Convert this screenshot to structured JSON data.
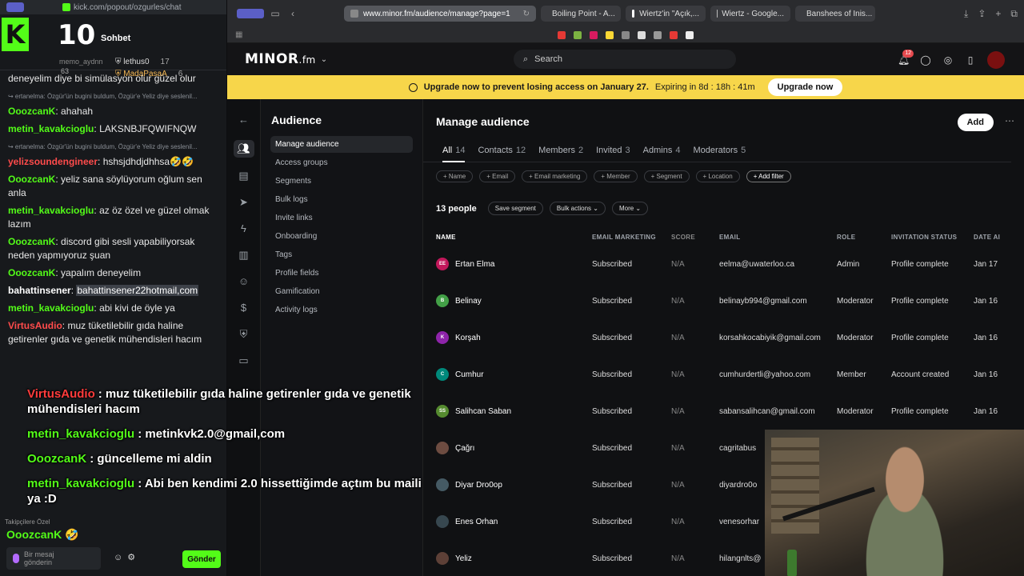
{
  "kick": {
    "url": "kick.com/popout/ozgurles/chat",
    "header_count": "10",
    "header_title": "Sohbet",
    "sub_user": "memo_aydnn",
    "sub_num": "63",
    "leaders": [
      {
        "name": "lethus0",
        "num": "17"
      },
      {
        "name": "MadaPasaA",
        "num": "6"
      }
    ],
    "messages": [
      {
        "type": "text",
        "text": "deneyelim diye bi simülasyon olur güzel olur"
      },
      {
        "type": "reply",
        "text": "↪ ertanelma: Özgür'ün bugini buldum, Özgür'e Yeliz diye seslenil..."
      },
      {
        "type": "msg",
        "user": "OoozcanK",
        "text": "ahahah"
      },
      {
        "type": "msg",
        "user": "metin_kavakcioglu",
        "text": "LAKSNBJFQWIFNQW"
      },
      {
        "type": "reply",
        "text": "↪ ertanelma: Özgür'ün bugini buldum, Özgür'e Yeliz diye seslenil..."
      },
      {
        "type": "msg",
        "user": "yelizsoundengineer",
        "text": "hshsjdhdjdhhsa🤣🤣",
        "red": true
      },
      {
        "type": "msg",
        "user": "OoozcanK",
        "text": "yeliz sana söylüyorum oğlum sen anla"
      },
      {
        "type": "msg",
        "user": "metin_kavakcioglu",
        "text": "az öz özel ve güzel olmak lazım"
      },
      {
        "type": "msg",
        "user": "OoozcanK",
        "text": "discord gibi sesli yapabiliyorsak neden yapmıyoruz şuan"
      },
      {
        "type": "msg",
        "user": "OoozcanK",
        "text": "yapalım deneyelim"
      },
      {
        "type": "msg",
        "user": "bahattinsener",
        "text": "bahattinsener22hotmail,com",
        "white": true,
        "hl": true
      },
      {
        "type": "msg",
        "user": "metin_kavakcioglu",
        "text": "abi kivi de öyle ya"
      },
      {
        "type": "msg",
        "user": "VirtusAudio",
        "text": "muz tüketilebilir gıda haline getirenler gıda ve genetik mühendisleri hacım",
        "red": true
      }
    ],
    "pinned": "Takipçilere Özel",
    "emote_user": "OoozcanK",
    "input_placeholder": "Bir mesaj gönderin",
    "send_label": "Gönder"
  },
  "overlay": [
    {
      "user": "VirtusAudio",
      "text": ": muz tüketilebilir gıda haline getirenler gıda ve genetik mühendisleri hacım",
      "color": "#ff3b3b"
    },
    {
      "user": "metin_kavakcioglu",
      "text": ": metinkvk2.0@gmail,com",
      "color": "#53fc18"
    },
    {
      "user": "OoozcanK",
      "text": ": güncelleme mi aldin",
      "color": "#53fc18"
    },
    {
      "user": "metin_kavakcioglu",
      "text": ": Abi ben kendimi 2.0 hissettiğimde açtım bu maili ya :D",
      "color": "#53fc18"
    }
  ],
  "browser": {
    "url": "www.minor.fm/audience/manage?page=1",
    "tabs": [
      "Boiling Point - A...",
      "Wiertz'in \"Açık,...",
      "Wiertz - Google...",
      "Banshees of Inis..."
    ]
  },
  "app": {
    "brand": "MINOR",
    "brand_suffix": ".fm",
    "search_placeholder": "Search",
    "notif_count": "12",
    "banner_text": "Upgrade now to prevent losing access on January 27.",
    "banner_expiry": "Expiring in 8d : 18h : 41m",
    "upgrade_label": "Upgrade now",
    "section_title": "Audience",
    "subnav": [
      "Manage audience",
      "Access groups",
      "Segments",
      "Bulk logs",
      "Invite links",
      "Onboarding",
      "Tags",
      "Profile fields",
      "Gamification",
      "Activity logs"
    ],
    "page_title": "Manage audience",
    "add_label": "Add",
    "tabs": [
      {
        "label": "All",
        "n": "14"
      },
      {
        "label": "Contacts",
        "n": "12"
      },
      {
        "label": "Members",
        "n": "2"
      },
      {
        "label": "Invited",
        "n": "3"
      },
      {
        "label": "Admins",
        "n": "4"
      },
      {
        "label": "Moderators",
        "n": "5"
      }
    ],
    "filters": [
      "+ Name",
      "+ Email",
      "+ Email marketing",
      "+ Member",
      "+ Segment",
      "+ Location",
      "+ Add filter"
    ],
    "people_count": "13 people",
    "save_segment": "Save segment",
    "bulk_actions": "Bulk actions ⌄",
    "more": "More ⌄",
    "columns": [
      "NAME",
      "EMAIL MARKETING",
      "SCORE",
      "EMAIL",
      "ROLE",
      "INVITATION STATUS",
      "DATE AI"
    ],
    "rows": [
      {
        "initials": "EE",
        "color": "#c2185b",
        "name": "Ertan Elma",
        "em": "Subscribed",
        "score": "N/A",
        "email": "eelma@uwaterloo.ca",
        "role": "Admin",
        "inv": "Profile complete",
        "date": "Jan 17"
      },
      {
        "initials": "B",
        "color": "#43a047",
        "name": "Belinay",
        "em": "Subscribed",
        "score": "N/A",
        "email": "belinayb994@gmail.com",
        "role": "Moderator",
        "inv": "Profile complete",
        "date": "Jan 16"
      },
      {
        "initials": "K",
        "color": "#8e24aa",
        "name": "Korşah",
        "em": "Subscribed",
        "score": "N/A",
        "email": "korsahkocabiyik@gmail.com",
        "role": "Moderator",
        "inv": "Profile complete",
        "date": "Jan 16"
      },
      {
        "initials": "C",
        "color": "#00897b",
        "name": "Cumhur",
        "em": "Subscribed",
        "score": "N/A",
        "email": "cumhurdertli@yahoo.com",
        "role": "Member",
        "inv": "Account created",
        "date": "Jan 16"
      },
      {
        "initials": "SS",
        "color": "#558b2f",
        "name": "Salihcan Saban",
        "em": "Subscribed",
        "score": "N/A",
        "email": "sabansalihcan@gmail.com",
        "role": "Moderator",
        "inv": "Profile complete",
        "date": "Jan 16"
      },
      {
        "initials": "",
        "color": "#6d4c41",
        "name": "Çağrı",
        "em": "Subscribed",
        "score": "N/A",
        "email": "cagritabus",
        "role": "",
        "inv": "",
        "date": ""
      },
      {
        "initials": "",
        "color": "#455a64",
        "name": "Diyar Dro0op",
        "em": "Subscribed",
        "score": "N/A",
        "email": "diyardro0o",
        "role": "",
        "inv": "",
        "date": ""
      },
      {
        "initials": "",
        "color": "#37474f",
        "name": "Enes Orhan",
        "em": "Subscribed",
        "score": "N/A",
        "email": "venesorhar",
        "role": "",
        "inv": "",
        "date": ""
      },
      {
        "initials": "",
        "color": "#5d4037",
        "name": "Yeliz",
        "em": "Subscribed",
        "score": "N/A",
        "email": "hilangnlts@",
        "role": "",
        "inv": "",
        "date": ""
      }
    ]
  }
}
